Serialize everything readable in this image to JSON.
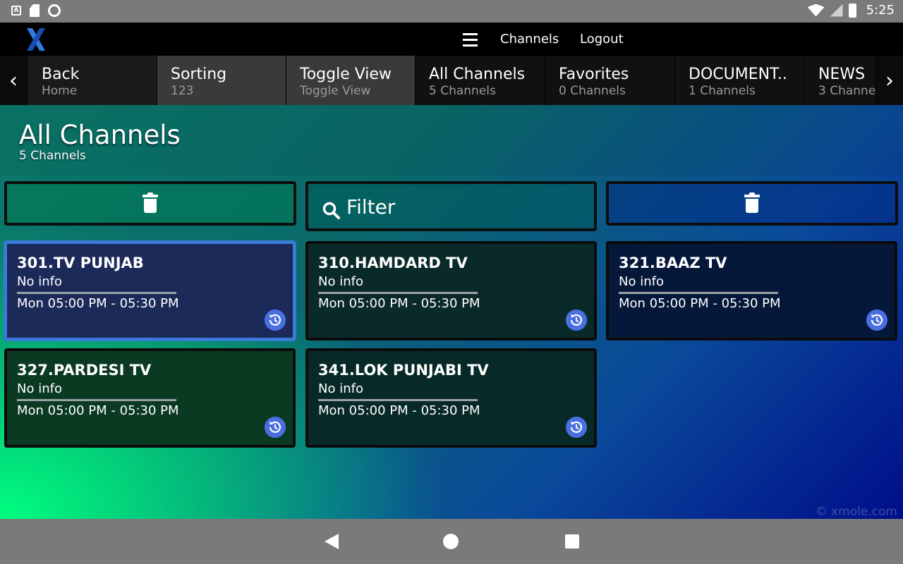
{
  "status_bar": {
    "time": "5:25"
  },
  "app_bar": {
    "logo": "X",
    "menu_icon": "hamburger-menu-icon",
    "links": [
      "Channels",
      "Logout"
    ]
  },
  "category_bar": {
    "items": [
      {
        "title": "Back",
        "subtitle": "Home"
      },
      {
        "title": "Sorting",
        "subtitle": "123"
      },
      {
        "title": "Toggle View",
        "subtitle": "Toggle View"
      },
      {
        "title": "All Channels",
        "subtitle": "5 Channels"
      },
      {
        "title": "Favorites",
        "subtitle": "0 Channels"
      },
      {
        "title": "DOCUMENT..",
        "subtitle": "1 Channels"
      },
      {
        "title": "NEWS",
        "subtitle": "3 Channe"
      }
    ]
  },
  "section": {
    "title": "All Channels",
    "subtitle": "5 Channels"
  },
  "toolbar": {
    "filter_label": "Filter"
  },
  "channels": [
    {
      "name": "301.TV PUNJAB",
      "info": "No info",
      "time": "Mon 05:00 PM - 05:30 PM"
    },
    {
      "name": "310.HAMDARD TV",
      "info": "No info",
      "time": "Mon 05:00 PM - 05:30 PM"
    },
    {
      "name": "321.BAAZ TV",
      "info": "No info",
      "time": "Mon 05:00 PM - 05:30 PM"
    },
    {
      "name": "327.PARDESI TV",
      "info": "No info",
      "time": "Mon 05:00 PM - 05:30 PM"
    },
    {
      "name": "341.LOK PUNJABI TV",
      "info": "No info",
      "time": "Mon 05:00 PM - 05:30 PM"
    }
  ],
  "watermark": "© xmole.com",
  "colors": {
    "accent": "#4a6fe0",
    "selected_border": "#3a7ad8"
  }
}
